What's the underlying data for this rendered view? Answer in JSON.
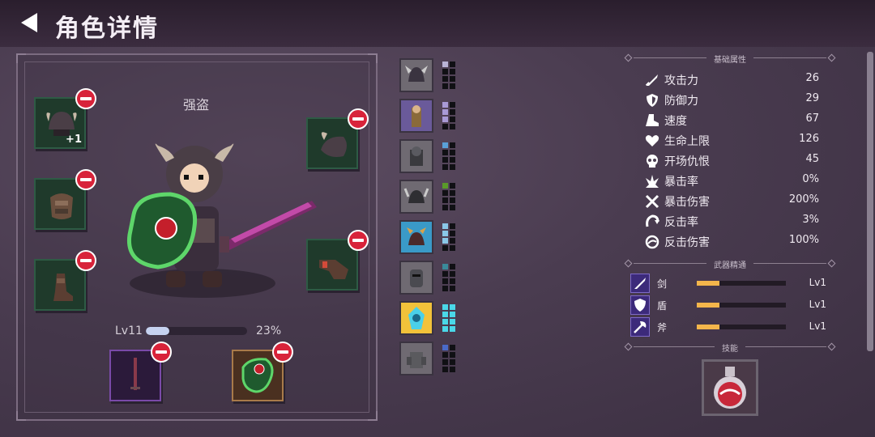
{
  "header": {
    "title": "角色详情"
  },
  "character": {
    "name": "强盗",
    "level_label": "Lv11",
    "exp_percent_label": "23%",
    "exp_fraction": 0.23,
    "helmet_bonus": "+1"
  },
  "stats_section": {
    "title": "基础属性",
    "rows": [
      {
        "label": "攻击力",
        "value": "26",
        "icon": "sword-icon"
      },
      {
        "label": "防御力",
        "value": "29",
        "icon": "shield-icon"
      },
      {
        "label": "速度",
        "value": "67",
        "icon": "boot-icon"
      },
      {
        "label": "生命上限",
        "value": "126",
        "icon": "heart-icon"
      },
      {
        "label": "开场仇恨",
        "value": "45",
        "icon": "skull-icon"
      },
      {
        "label": "暴击率",
        "value": "0%",
        "icon": "crit-icon"
      },
      {
        "label": "暴击伤害",
        "value": "200%",
        "icon": "crossed-swords-icon"
      },
      {
        "label": "反击率",
        "value": "3%",
        "icon": "counter-icon"
      },
      {
        "label": "反击伤害",
        "value": "100%",
        "icon": "counter-damage-icon"
      }
    ]
  },
  "mastery_section": {
    "title": "武器精通",
    "rows": [
      {
        "label": "剑",
        "level": "Lv1",
        "fraction": 0.25
      },
      {
        "label": "盾",
        "level": "Lv1",
        "fraction": 0.25
      },
      {
        "label": "斧",
        "level": "Lv1",
        "fraction": 0.25
      }
    ]
  },
  "skills_section": {
    "title": "技能"
  },
  "colors": {
    "accent": "#f4b64b",
    "remove": "#d8233a",
    "equip_bg": "#1f3a2b",
    "exp_fill": "#c6d2f0"
  }
}
